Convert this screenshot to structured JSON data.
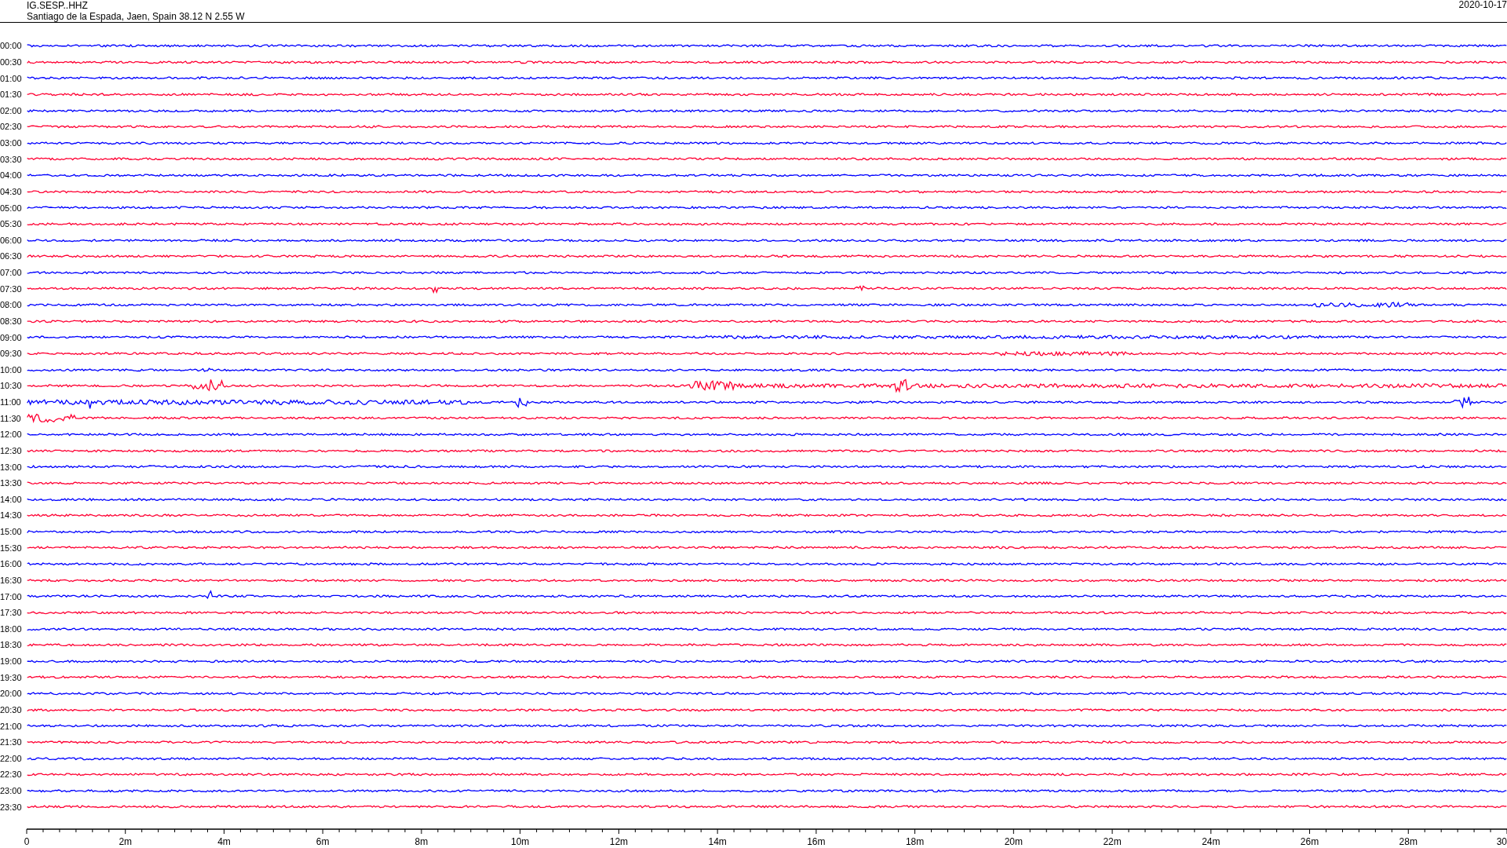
{
  "header": {
    "station": "IG.SESP..HHZ",
    "location": "Santiago de la Espada, Jaen, Spain  38.12 N 2.55 W",
    "date": "2020-10-17"
  },
  "traces": [
    {
      "time": "00:00",
      "color": "#0000ff"
    },
    {
      "time": "00:30",
      "color": "#ff0033"
    },
    {
      "time": "01:00",
      "color": "#0000ff"
    },
    {
      "time": "01:30",
      "color": "#ff0033"
    },
    {
      "time": "02:00",
      "color": "#0000ff"
    },
    {
      "time": "02:30",
      "color": "#ff0033"
    },
    {
      "time": "03:00",
      "color": "#0000ff"
    },
    {
      "time": "03:30",
      "color": "#ff0033"
    },
    {
      "time": "04:00",
      "color": "#0000ff"
    },
    {
      "time": "04:30",
      "color": "#ff0033"
    },
    {
      "time": "05:00",
      "color": "#0000ff"
    },
    {
      "time": "05:30",
      "color": "#ff0033"
    },
    {
      "time": "06:00",
      "color": "#0000ff"
    },
    {
      "time": "06:30",
      "color": "#ff0033"
    },
    {
      "time": "07:00",
      "color": "#0000ff"
    },
    {
      "time": "07:30",
      "color": "#ff0033"
    },
    {
      "time": "08:00",
      "color": "#0000ff"
    },
    {
      "time": "08:30",
      "color": "#ff0033"
    },
    {
      "time": "09:00",
      "color": "#0000ff"
    },
    {
      "time": "09:30",
      "color": "#ff0033"
    },
    {
      "time": "10:00",
      "color": "#0000ff"
    },
    {
      "time": "10:30",
      "color": "#ff0033"
    },
    {
      "time": "11:00",
      "color": "#0000ff"
    },
    {
      "time": "11:30",
      "color": "#ff0033"
    },
    {
      "time": "12:00",
      "color": "#0000ff"
    },
    {
      "time": "12:30",
      "color": "#ff0033"
    },
    {
      "time": "13:00",
      "color": "#0000ff"
    },
    {
      "time": "13:30",
      "color": "#ff0033"
    },
    {
      "time": "14:00",
      "color": "#0000ff"
    },
    {
      "time": "14:30",
      "color": "#ff0033"
    },
    {
      "time": "15:00",
      "color": "#0000ff"
    },
    {
      "time": "15:30",
      "color": "#ff0033"
    },
    {
      "time": "16:00",
      "color": "#0000ff"
    },
    {
      "time": "16:30",
      "color": "#ff0033"
    },
    {
      "time": "17:00",
      "color": "#0000ff"
    },
    {
      "time": "17:30",
      "color": "#ff0033"
    },
    {
      "time": "18:00",
      "color": "#0000ff"
    },
    {
      "time": "18:30",
      "color": "#ff0033"
    },
    {
      "time": "19:00",
      "color": "#0000ff"
    },
    {
      "time": "19:30",
      "color": "#ff0033"
    },
    {
      "time": "20:00",
      "color": "#0000ff"
    },
    {
      "time": "20:30",
      "color": "#ff0033"
    },
    {
      "time": "21:00",
      "color": "#0000ff"
    },
    {
      "time": "21:30",
      "color": "#ff0033"
    },
    {
      "time": "22:00",
      "color": "#0000ff"
    },
    {
      "time": "22:30",
      "color": "#ff0033"
    },
    {
      "time": "23:00",
      "color": "#0000ff"
    },
    {
      "time": "23:30",
      "color": "#ff0033"
    }
  ],
  "axis": {
    "labels": [
      "0",
      "2m",
      "4m",
      "6m",
      "8m",
      "10m",
      "12m",
      "14m",
      "16m",
      "18m",
      "20m",
      "22m",
      "24m",
      "26m",
      "28m",
      "30"
    ]
  }
}
